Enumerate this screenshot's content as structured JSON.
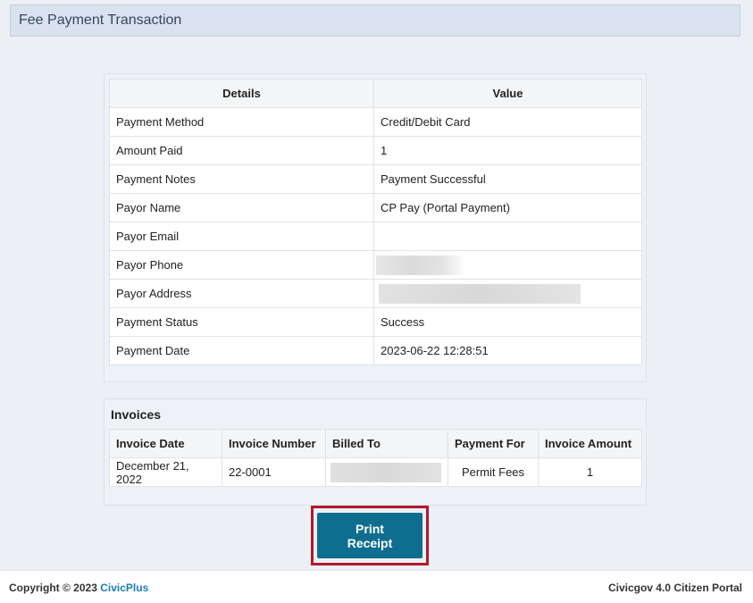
{
  "page": {
    "title": "Fee Payment Transaction"
  },
  "details": {
    "headers": {
      "details": "Details",
      "value": "Value"
    },
    "rows": [
      {
        "label": "Payment Method",
        "value": "Credit/Debit Card"
      },
      {
        "label": "Amount Paid",
        "value": "1"
      },
      {
        "label": "Payment Notes",
        "value": "Payment Successful"
      },
      {
        "label": "Payor Name",
        "value": "CP Pay (Portal Payment)"
      },
      {
        "label": "Payor Email",
        "value": ""
      },
      {
        "label": "Payor Phone",
        "value": ""
      },
      {
        "label": "Payor Address",
        "value": ""
      },
      {
        "label": "Payment Status",
        "value": "Success"
      },
      {
        "label": "Payment Date",
        "value": "2023-06-22 12:28:51"
      }
    ]
  },
  "invoices": {
    "title": "Invoices",
    "headers": {
      "date": "Invoice Date",
      "number": "Invoice Number",
      "billed_to": "Billed To",
      "payment_for": "Payment For",
      "amount": "Invoice Amount"
    },
    "rows": [
      {
        "date": "December 21, 2022",
        "number": "22-0001",
        "billed_to": "",
        "payment_for": "Permit Fees",
        "amount": "1"
      }
    ]
  },
  "actions": {
    "print_label_line1": "Print",
    "print_label_line2": "Receipt"
  },
  "footer": {
    "copyright": "Copyright © 2023",
    "brand": "CivicPlus",
    "portal": "Civicgov 4.0 Citizen Portal"
  }
}
